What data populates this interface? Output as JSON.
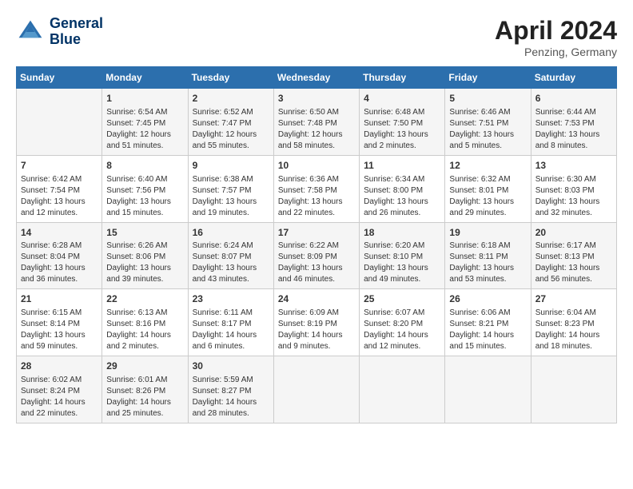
{
  "header": {
    "logo_line1": "General",
    "logo_line2": "Blue",
    "month": "April 2024",
    "location": "Penzing, Germany"
  },
  "days_of_week": [
    "Sunday",
    "Monday",
    "Tuesday",
    "Wednesday",
    "Thursday",
    "Friday",
    "Saturday"
  ],
  "weeks": [
    [
      {
        "day": "",
        "info": ""
      },
      {
        "day": "1",
        "info": "Sunrise: 6:54 AM\nSunset: 7:45 PM\nDaylight: 12 hours\nand 51 minutes."
      },
      {
        "day": "2",
        "info": "Sunrise: 6:52 AM\nSunset: 7:47 PM\nDaylight: 12 hours\nand 55 minutes."
      },
      {
        "day": "3",
        "info": "Sunrise: 6:50 AM\nSunset: 7:48 PM\nDaylight: 12 hours\nand 58 minutes."
      },
      {
        "day": "4",
        "info": "Sunrise: 6:48 AM\nSunset: 7:50 PM\nDaylight: 13 hours\nand 2 minutes."
      },
      {
        "day": "5",
        "info": "Sunrise: 6:46 AM\nSunset: 7:51 PM\nDaylight: 13 hours\nand 5 minutes."
      },
      {
        "day": "6",
        "info": "Sunrise: 6:44 AM\nSunset: 7:53 PM\nDaylight: 13 hours\nand 8 minutes."
      }
    ],
    [
      {
        "day": "7",
        "info": "Sunrise: 6:42 AM\nSunset: 7:54 PM\nDaylight: 13 hours\nand 12 minutes."
      },
      {
        "day": "8",
        "info": "Sunrise: 6:40 AM\nSunset: 7:56 PM\nDaylight: 13 hours\nand 15 minutes."
      },
      {
        "day": "9",
        "info": "Sunrise: 6:38 AM\nSunset: 7:57 PM\nDaylight: 13 hours\nand 19 minutes."
      },
      {
        "day": "10",
        "info": "Sunrise: 6:36 AM\nSunset: 7:58 PM\nDaylight: 13 hours\nand 22 minutes."
      },
      {
        "day": "11",
        "info": "Sunrise: 6:34 AM\nSunset: 8:00 PM\nDaylight: 13 hours\nand 26 minutes."
      },
      {
        "day": "12",
        "info": "Sunrise: 6:32 AM\nSunset: 8:01 PM\nDaylight: 13 hours\nand 29 minutes."
      },
      {
        "day": "13",
        "info": "Sunrise: 6:30 AM\nSunset: 8:03 PM\nDaylight: 13 hours\nand 32 minutes."
      }
    ],
    [
      {
        "day": "14",
        "info": "Sunrise: 6:28 AM\nSunset: 8:04 PM\nDaylight: 13 hours\nand 36 minutes."
      },
      {
        "day": "15",
        "info": "Sunrise: 6:26 AM\nSunset: 8:06 PM\nDaylight: 13 hours\nand 39 minutes."
      },
      {
        "day": "16",
        "info": "Sunrise: 6:24 AM\nSunset: 8:07 PM\nDaylight: 13 hours\nand 43 minutes."
      },
      {
        "day": "17",
        "info": "Sunrise: 6:22 AM\nSunset: 8:09 PM\nDaylight: 13 hours\nand 46 minutes."
      },
      {
        "day": "18",
        "info": "Sunrise: 6:20 AM\nSunset: 8:10 PM\nDaylight: 13 hours\nand 49 minutes."
      },
      {
        "day": "19",
        "info": "Sunrise: 6:18 AM\nSunset: 8:11 PM\nDaylight: 13 hours\nand 53 minutes."
      },
      {
        "day": "20",
        "info": "Sunrise: 6:17 AM\nSunset: 8:13 PM\nDaylight: 13 hours\nand 56 minutes."
      }
    ],
    [
      {
        "day": "21",
        "info": "Sunrise: 6:15 AM\nSunset: 8:14 PM\nDaylight: 13 hours\nand 59 minutes."
      },
      {
        "day": "22",
        "info": "Sunrise: 6:13 AM\nSunset: 8:16 PM\nDaylight: 14 hours\nand 2 minutes."
      },
      {
        "day": "23",
        "info": "Sunrise: 6:11 AM\nSunset: 8:17 PM\nDaylight: 14 hours\nand 6 minutes."
      },
      {
        "day": "24",
        "info": "Sunrise: 6:09 AM\nSunset: 8:19 PM\nDaylight: 14 hours\nand 9 minutes."
      },
      {
        "day": "25",
        "info": "Sunrise: 6:07 AM\nSunset: 8:20 PM\nDaylight: 14 hours\nand 12 minutes."
      },
      {
        "day": "26",
        "info": "Sunrise: 6:06 AM\nSunset: 8:21 PM\nDaylight: 14 hours\nand 15 minutes."
      },
      {
        "day": "27",
        "info": "Sunrise: 6:04 AM\nSunset: 8:23 PM\nDaylight: 14 hours\nand 18 minutes."
      }
    ],
    [
      {
        "day": "28",
        "info": "Sunrise: 6:02 AM\nSunset: 8:24 PM\nDaylight: 14 hours\nand 22 minutes."
      },
      {
        "day": "29",
        "info": "Sunrise: 6:01 AM\nSunset: 8:26 PM\nDaylight: 14 hours\nand 25 minutes."
      },
      {
        "day": "30",
        "info": "Sunrise: 5:59 AM\nSunset: 8:27 PM\nDaylight: 14 hours\nand 28 minutes."
      },
      {
        "day": "",
        "info": ""
      },
      {
        "day": "",
        "info": ""
      },
      {
        "day": "",
        "info": ""
      },
      {
        "day": "",
        "info": ""
      }
    ]
  ]
}
